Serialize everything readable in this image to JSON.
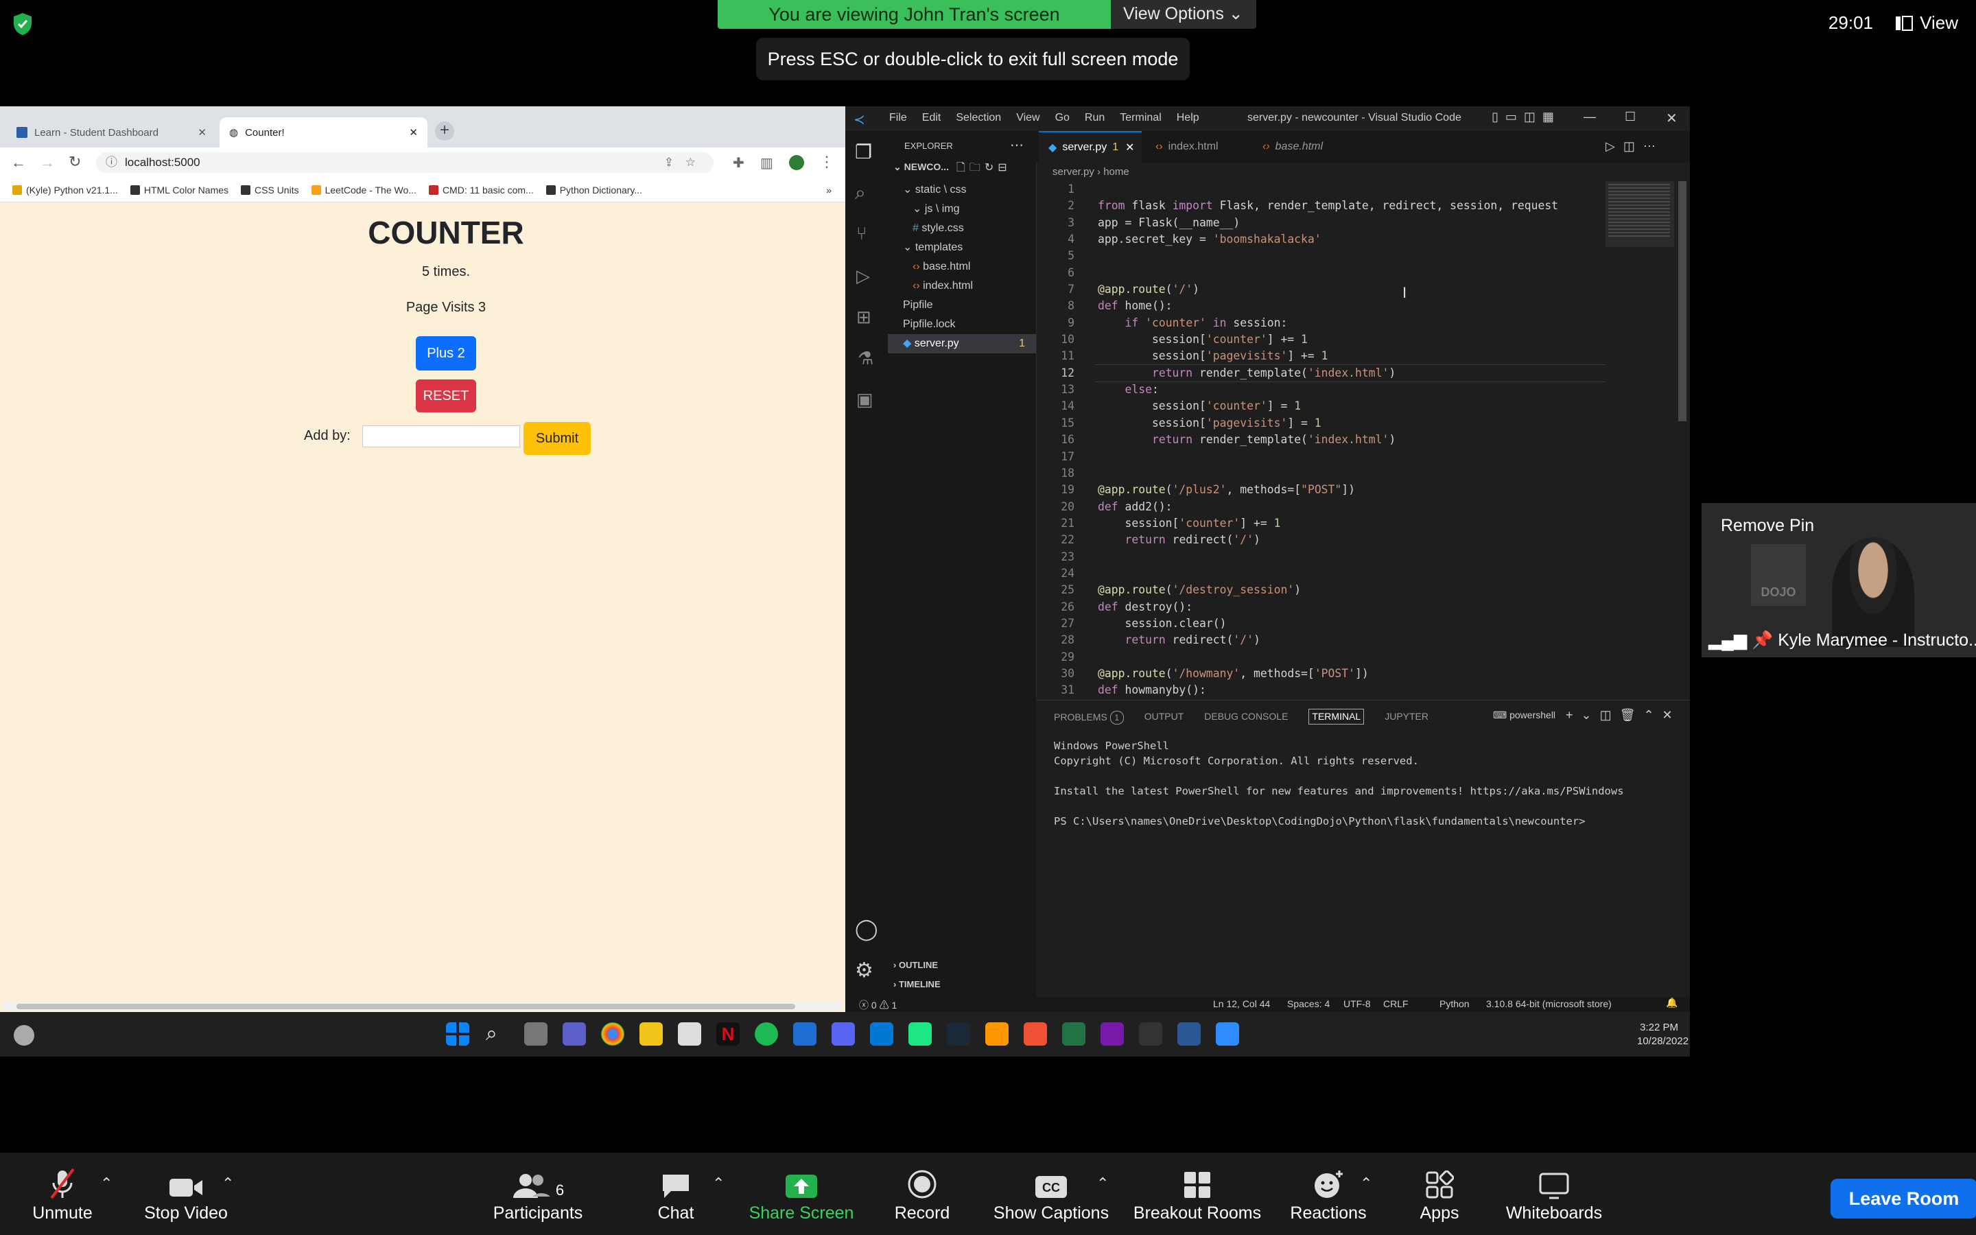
{
  "zoom": {
    "banner_text": "You are viewing John Tran's screen",
    "view_options_label": "View Options",
    "esc_message": "Press ESC or double-click to exit full screen mode",
    "timer": "29:01",
    "view_label": "View",
    "remove_pin_label": "Remove Pin",
    "participant_name": "Kyle Marymee - Instructo...",
    "participant_count": "6",
    "toolbar": {
      "unmute": "Unmute",
      "stop_video": "Stop Video",
      "participants": "Participants",
      "chat": "Chat",
      "share_screen": "Share Screen",
      "record": "Record",
      "show_captions": "Show Captions",
      "breakout_rooms": "Breakout Rooms",
      "reactions": "Reactions",
      "apps": "Apps",
      "whiteboards": "Whiteboards",
      "leave_room": "Leave Room"
    }
  },
  "browser": {
    "tabs": [
      {
        "label": "Learn - Student Dashboard"
      },
      {
        "label": "Counter!"
      }
    ],
    "address": "localhost:5000",
    "bookmarks": [
      "(Kyle) Python v21.1...",
      "HTML Color Names",
      "CSS Units",
      "LeetCode - The Wo...",
      "CMD: 11 basic com...",
      "Python Dictionary..."
    ],
    "page": {
      "title": "COUNTER",
      "count_text": "5 times.",
      "visits_text": "Page Visits 3",
      "plus_button": "Plus 2",
      "reset_button": "RESET",
      "add_by_label": "Add by:",
      "submit_button": "Submit"
    }
  },
  "vscode": {
    "menu": [
      "File",
      "Edit",
      "Selection",
      "View",
      "Go",
      "Run",
      "Terminal",
      "Help"
    ],
    "window_title": "server.py - newcounter - Visual Studio Code",
    "explorer_title": "EXPLORER",
    "folder_name": "NEWCO...",
    "tree": [
      {
        "label": "static \\ css",
        "indent": 1
      },
      {
        "label": "js \\ img",
        "indent": 2
      },
      {
        "label": "style.css",
        "indent": 2
      },
      {
        "label": "templates",
        "indent": 1
      },
      {
        "label": "base.html",
        "indent": 2
      },
      {
        "label": "index.html",
        "indent": 2
      },
      {
        "label": "Pipfile",
        "indent": 1
      },
      {
        "label": "Pipfile.lock",
        "indent": 1
      },
      {
        "label": "server.py",
        "indent": 1,
        "badge": "1"
      }
    ],
    "outline_label": "OUTLINE",
    "timeline_label": "TIMELINE",
    "editor_tabs": [
      {
        "label": "server.py",
        "badge": "1"
      },
      {
        "label": "index.html"
      },
      {
        "label": "base.html"
      }
    ],
    "breadcrumb": [
      "server.py",
      "home"
    ],
    "code_lines": [
      "",
      "from flask import Flask, render_template, redirect, session, request",
      "app = Flask(__name__)",
      "app.secret_key = 'boomshakalacka'",
      "",
      "",
      "@app.route('/')",
      "def home():",
      "    if 'counter' in session:",
      "        session['counter'] += 1",
      "        session['pagevisits'] += 1",
      "        return render_template('index.html')",
      "    else:",
      "        session['counter'] = 1",
      "        session['pagevisits'] = 1",
      "        return render_template('index.html')",
      "",
      "",
      "@app.route('/plus2', methods=[\"POST\"])",
      "def add2():",
      "    session['counter'] += 1",
      "    return redirect('/')",
      "",
      "",
      "@app.route('/destroy_session')",
      "def destroy():",
      "    session.clear()",
      "    return redirect('/')",
      "",
      "@app.route('/howmany', methods=['POST'])",
      "def howmanyby():"
    ],
    "panel_tabs": [
      "PROBLEMS",
      "OUTPUT",
      "DEBUG CONSOLE",
      "TERMINAL",
      "JUPYTER"
    ],
    "problems_count": "1",
    "shell_label": "powershell",
    "terminal_lines": [
      "Windows PowerShell",
      "Copyright (C) Microsoft Corporation. All rights reserved.",
      "",
      "Install the latest PowerShell for new features and improvements! https://aka.ms/PSWindows",
      "",
      "PS C:\\Users\\names\\OneDrive\\Desktop\\CodingDojo\\Python\\flask\\fundamentals\\newcounter>"
    ],
    "status": {
      "errors": "ⓧ 0 ⚠ 1",
      "position": "Ln 12, Col 44",
      "spaces": "Spaces: 4",
      "encoding": "UTF-8",
      "eol": "CRLF",
      "language": "Python",
      "interpreter": "3.10.8 64-bit (microsoft store)"
    }
  },
  "taskbar": {
    "time": "3:22 PM",
    "date": "10/28/2022"
  },
  "colors": {
    "zoom_green": "#3bbf5a",
    "leave_blue": "#0e71eb",
    "plus_blue": "#0d6efd",
    "reset_red": "#dc3545",
    "submit_yellow": "#ffc107",
    "page_bg": "#fdf0d8"
  }
}
